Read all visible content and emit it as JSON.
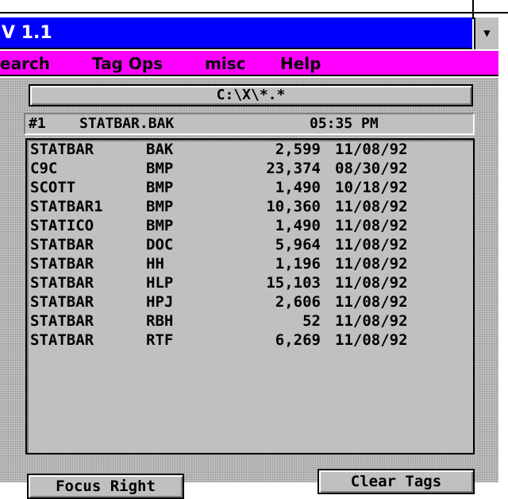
{
  "app": {
    "title": "V 1.1",
    "system_menu_icon": "down-arrow-icon"
  },
  "menu": {
    "items": [
      "earch",
      "Tag Ops",
      "misc",
      "Help"
    ]
  },
  "path_button": {
    "label": "C:\\X\\*.*"
  },
  "status": {
    "index": "#1",
    "filename": "STATBAR.BAK",
    "time": "05:35 PM"
  },
  "files": [
    {
      "name": "STATBAR",
      "ext": "BAK",
      "size": "2,599",
      "date": "11/08/92"
    },
    {
      "name": "C9C",
      "ext": "BMP",
      "size": "23,374",
      "date": "08/30/92"
    },
    {
      "name": "SCOTT",
      "ext": "BMP",
      "size": "1,490",
      "date": "10/18/92"
    },
    {
      "name": "STATBAR1",
      "ext": "BMP",
      "size": "10,360",
      "date": "11/08/92"
    },
    {
      "name": "STATICO",
      "ext": "BMP",
      "size": "1,490",
      "date": "11/08/92"
    },
    {
      "name": "STATBAR",
      "ext": "DOC",
      "size": "5,964",
      "date": "11/08/92"
    },
    {
      "name": "STATBAR",
      "ext": "HH",
      "size": "1,196",
      "date": "11/08/92"
    },
    {
      "name": "STATBAR",
      "ext": "HLP",
      "size": "15,103",
      "date": "11/08/92"
    },
    {
      "name": "STATBAR",
      "ext": "HPJ",
      "size": "2,606",
      "date": "11/08/92"
    },
    {
      "name": "STATBAR",
      "ext": "RBH",
      "size": "52",
      "date": "11/08/92"
    },
    {
      "name": "STATBAR",
      "ext": "RTF",
      "size": "6,269",
      "date": "11/08/92"
    }
  ],
  "buttons": {
    "focus_right": "Focus Right",
    "clear_tags": "Clear Tags"
  },
  "colors": {
    "title_bar": "#0000ff",
    "menu_bar": "#ff00ff",
    "face": "#c0c0c0"
  }
}
